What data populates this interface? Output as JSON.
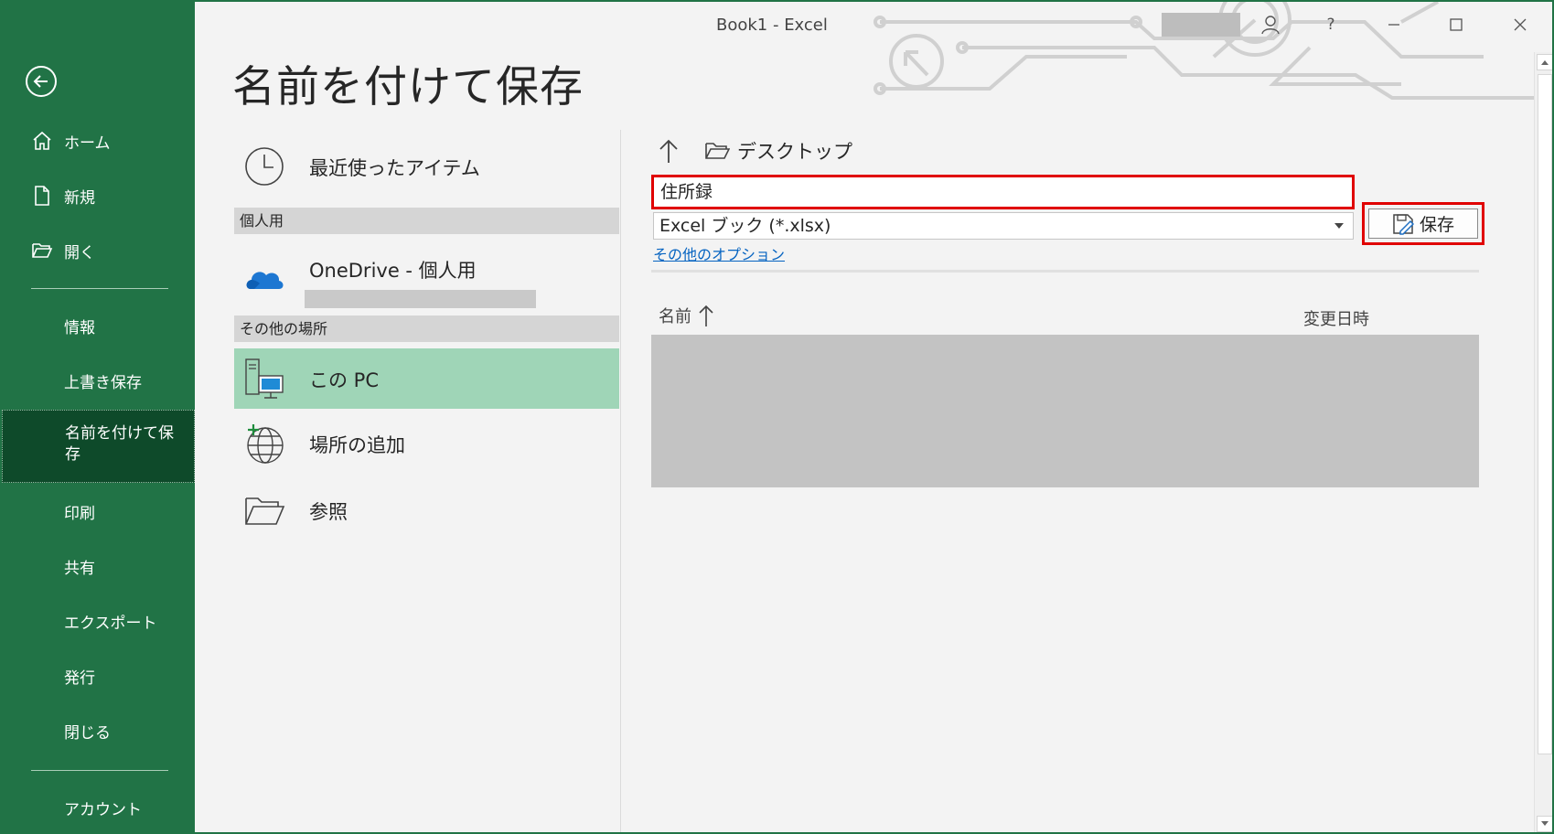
{
  "window": {
    "title": "Book1  -  Excel",
    "help": "?"
  },
  "nav": {
    "items": [
      {
        "label": "ホーム"
      },
      {
        "label": "新規"
      },
      {
        "label": "開く"
      },
      {
        "label": "情報"
      },
      {
        "label": "上書き保存"
      },
      {
        "label": "名前を付けて保存"
      },
      {
        "label": "印刷"
      },
      {
        "label": "共有"
      },
      {
        "label": "エクスポート"
      },
      {
        "label": "発行"
      },
      {
        "label": "閉じる"
      },
      {
        "label": "アカウント"
      }
    ]
  },
  "page": {
    "title": "名前を付けて保存"
  },
  "locations": {
    "recent": "最近使ったアイテム",
    "personal_header": "個人用",
    "onedrive": "OneDrive - 個人用",
    "other_header": "その他の場所",
    "this_pc": "この PC",
    "add_place": "場所の追加",
    "browse": "参照"
  },
  "save": {
    "current_folder": "デスクトップ",
    "filename": "住所録",
    "filetype": "Excel ブック (*.xlsx)",
    "more_options": "その他のオプション",
    "save_label": "保存"
  },
  "filelist": {
    "col_name": "名前",
    "col_modified": "変更日時"
  },
  "colors": {
    "nav_green": "#217346",
    "nav_active": "#0e4a2a",
    "selected_location": "#9fd5b7",
    "highlight_red": "#e00000",
    "link_blue": "#0563c1"
  }
}
